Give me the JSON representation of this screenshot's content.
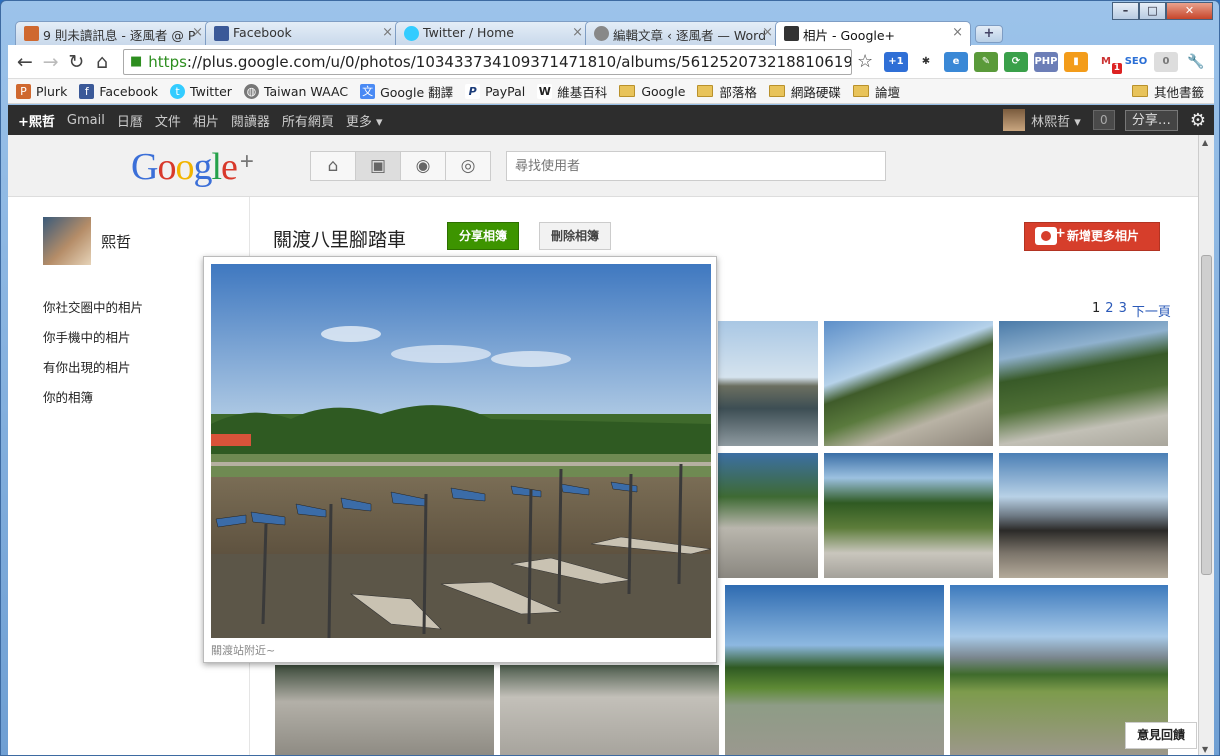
{
  "browser": {
    "tabs": [
      {
        "title": "9 則未讀訊息 - 逐風者 @ P",
        "icon": "plurk-icon",
        "color": "#cf682f"
      },
      {
        "title": "Facebook",
        "icon": "facebook-icon",
        "color": "#3b5998"
      },
      {
        "title": "Twitter / Home",
        "icon": "twitter-icon",
        "color": "#33ccff"
      },
      {
        "title": "編輯文章 ‹ 逐風者 — Word",
        "icon": "wordpress-icon",
        "color": "#666666"
      },
      {
        "title": "相片 - Google+",
        "icon": "google-plus-icon",
        "color": "#333333"
      }
    ],
    "close_glyph": "×",
    "url_https": "https",
    "url_rest": "://plus.google.com/u/0/photos/103433734109371471810/albums/5612520732188106193",
    "bookmarks": [
      {
        "label": "Plurk",
        "icon": "plurk-icon"
      },
      {
        "label": "Facebook",
        "icon": "facebook-icon"
      },
      {
        "label": "Twitter",
        "icon": "twitter-icon"
      },
      {
        "label": "Taiwan WAAC",
        "icon": "globe-icon"
      },
      {
        "label": "Google 翻譯",
        "icon": "translate-icon"
      },
      {
        "label": "PayPal",
        "icon": "paypal-icon"
      },
      {
        "label": "維基百科",
        "icon": "wikipedia-icon"
      },
      {
        "label": "Google",
        "icon": "folder-icon"
      },
      {
        "label": "部落格",
        "icon": "folder-icon"
      },
      {
        "label": "網路硬碟",
        "icon": "folder-icon"
      },
      {
        "label": "論壇",
        "icon": "folder-icon"
      }
    ],
    "other_bookmarks": "其他書籤",
    "ext_badges": {
      "gmail_count": "1",
      "gray_count": "0"
    }
  },
  "gbar": {
    "me": "+熙哲",
    "links": [
      "Gmail",
      "日曆",
      "文件",
      "相片",
      "閱讀器",
      "所有網頁",
      "更多 ▾"
    ],
    "user": "林熙哲 ▾",
    "notif_count": "0",
    "share": "分享…"
  },
  "gplus": {
    "search_placeholder": "尋找使用者",
    "profile_name": "熙哲",
    "sidebar": [
      "你社交圈中的相片",
      "你手機中的相片",
      "有你出現的相片",
      "你的相簿"
    ],
    "album_title": "關渡八里腳踏車",
    "share_album": "分享相簿",
    "delete_album": "刪除相簿",
    "add_photos": "新增更多相片",
    "pager": {
      "current": "1",
      "pages": [
        "2",
        "3"
      ],
      "next": "下一頁"
    },
    "popup_caption": "關渡站附近~",
    "feedback": "意見回饋"
  },
  "colors": {
    "share_green": "#3d9400",
    "add_red": "#d63e2b",
    "link_blue": "#2a59b8"
  }
}
